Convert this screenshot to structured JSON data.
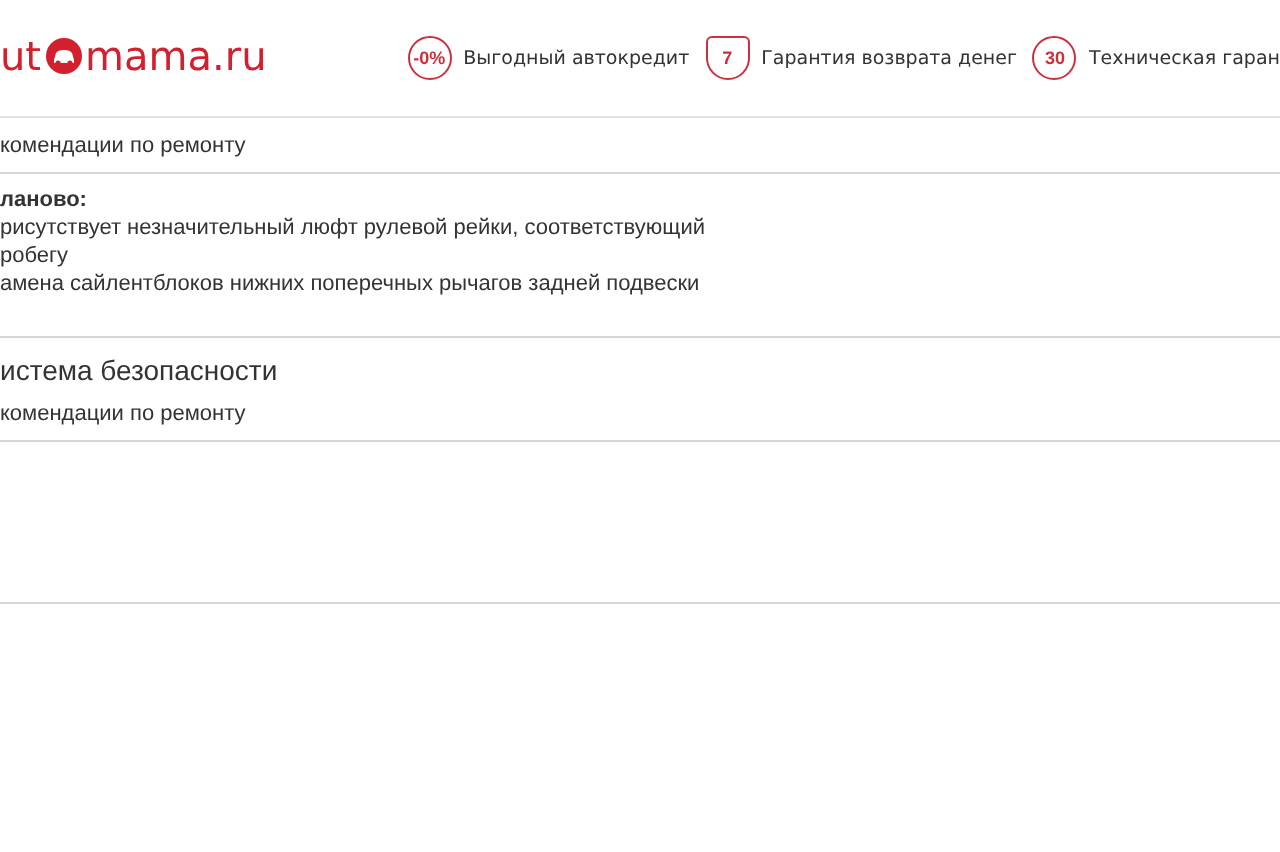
{
  "header": {
    "logo": {
      "left": "ut",
      "right": "mama.ru"
    },
    "badges": [
      {
        "kind": "percent",
        "value": "-0%",
        "caption": "Выгодный автокредит"
      },
      {
        "kind": "shield",
        "value": "7",
        "caption": "Гарантия возврата денег"
      },
      {
        "kind": "circle",
        "value": "30",
        "caption": "Техническая гаран"
      }
    ]
  },
  "sections": [
    {
      "subheading": "комендации по ремонту",
      "note": {
        "title": "ланово:",
        "lines": [
          "рисутствует незначительный люфт рулевой рейки, соответствующий",
          "робегу",
          "амена сайлентблоков нижних поперечных рычагов задней подвески"
        ]
      }
    },
    {
      "heading": "истема безопасности",
      "subheading": "комендации по ремонту"
    }
  ]
}
